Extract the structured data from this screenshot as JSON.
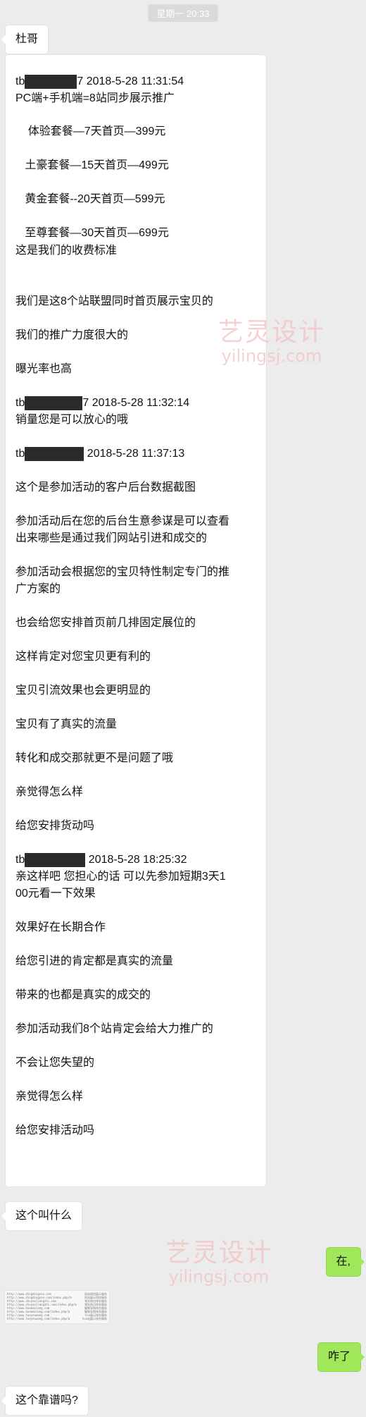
{
  "time_label": "星期一 20:33",
  "messages": {
    "m1": "杜哥",
    "m2_lines": [
      {
        "pre": "tb",
        "post": "7 2018-5-28 11:31:54"
      },
      "PC端+手机端=8站同步展示推广",
      "    体验套餐—7天首页—399元",
      "   土豪套餐—15天首页—499元",
      "   黄金套餐--20天首页—599元",
      "   至尊套餐—30天首页—699元",
      "这是我们的收费标准",
      "我们是这8个站联盟同时首页展示宝贝的",
      "我们的推广力度很大的",
      "曝光率也高",
      {
        "pre": "tb",
        "post": "7 2018-5-28 11:32:14"
      },
      "销量您是可以放心的哦",
      {
        "pre": "tb",
        "post": " 2018-5-28 11:37:13"
      },
      "这个是参加活动的客户后台数据截图",
      "参加活动后在您的后台生意参谋是可以查看",
      "出来哪些是通过我们网站引进和成交的",
      "参加活动会根据您的宝贝特性制定专门的推",
      "广方案的",
      "也会给您安排首页前几排固定展位的",
      "这样肯定对您宝贝更有利的",
      "宝贝引流效果也会更明显的",
      "宝贝有了真实的流量",
      "转化和成交那就更不是问题了哦",
      "亲觉得怎么样",
      "给您安排货动吗",
      {
        "pre": "tb",
        "post": " 2018-5-28 18:25:32"
      },
      "亲这样吧 您担心的话 可以先参加短期3天1",
      "00元看一下效果",
      "效果好在长期合作",
      "给您引进的肯定都是真实的流量",
      "带来的也都是真实的成交的",
      "参加活动我们8个站肯定会给大力推广的",
      "不会让您失望的",
      "亲觉得怎么样",
      "给您安排活动吗"
    ],
    "m3": "这个叫什么",
    "m4": "在,",
    "m5": "咋了",
    "m6": "这个靠谱吗?"
  },
  "watermark": {
    "cn": "艺灵设计",
    "en": "yilingsj.com"
  },
  "thumbnail_rows": [
    {
      "url": "http://www.dingdingsoo.com",
      "note": "同站同时展示服务"
    },
    {
      "url": "http://www.dingdingsoo.com/index.php/m",
      "note": "同站展示同时服务"
    },
    {
      "url": "http://www.zhuyaoliangzhi.com",
      "note": "领先热点排名服务"
    },
    {
      "url": "http://www.zhuyaoliangzhi.com/index.php/m",
      "note": "领先热点排名服务"
    },
    {
      "url": "http://www.huomaolang.com",
      "note": "猫咪导购排名服务"
    },
    {
      "url": "http://www.huomaolang.com/index.php/m",
      "note": "猫咪导购排名服务"
    },
    {
      "url": "http://www.tuoyouwang.com",
      "note": "tuo展示排名服务"
    },
    {
      "url": "http://www.tuoyouwang.com/index.php/m",
      "note": "tuo站展示排名服务"
    }
  ]
}
